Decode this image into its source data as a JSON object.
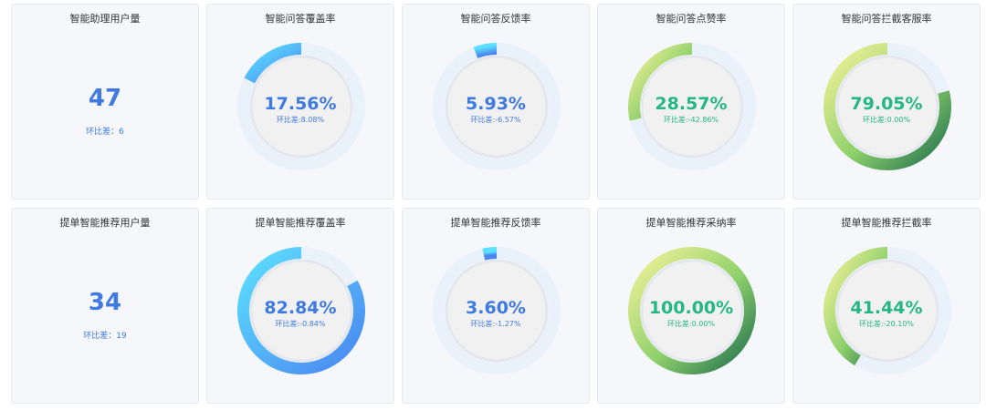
{
  "cards": [
    {
      "title": "智能助理用户量",
      "kind": "stat",
      "value": "47",
      "delta": "环比差：6"
    },
    {
      "title": "智能问答覆盖率",
      "kind": "gauge",
      "value": "17.56%",
      "delta": "环比差:8.08%",
      "fraction": 0.1756,
      "scheme": "cyan",
      "text_color": "#3f7ae0"
    },
    {
      "title": "智能问答反馈率",
      "kind": "gauge",
      "value": "5.93%",
      "delta": "环比差:-6.57%",
      "fraction": 0.0593,
      "scheme": "cyan",
      "text_color": "#3f7ae0"
    },
    {
      "title": "智能问答点赞率",
      "kind": "gauge",
      "value": "28.57%",
      "delta": "环比差:-42.86%",
      "fraction": 0.2857,
      "scheme": "green",
      "text_color": "#25b685"
    },
    {
      "title": "智能问答拦截客服率",
      "kind": "gauge",
      "value": "79.05%",
      "delta": "环比差:0.00%",
      "fraction": 0.7905,
      "scheme": "green",
      "text_color": "#25b685"
    },
    {
      "title": "提单智能推荐用户量",
      "kind": "stat",
      "value": "34",
      "delta": "环比差：19"
    },
    {
      "title": "提单智能推荐覆盖率",
      "kind": "gauge",
      "value": "82.84%",
      "delta": "环比差:-0.84%",
      "fraction": 0.8284,
      "scheme": "cyan",
      "text_color": "#3f7ae0"
    },
    {
      "title": "提单智能推荐反馈率",
      "kind": "gauge",
      "value": "3.60%",
      "delta": "环比差:-1.27%",
      "fraction": 0.036,
      "scheme": "cyan",
      "text_color": "#3f7ae0"
    },
    {
      "title": "提单智能推荐采纳率",
      "kind": "gauge",
      "value": "100.00%",
      "delta": "环比差:0.00%",
      "fraction": 1.0,
      "scheme": "green",
      "text_color": "#25b685"
    },
    {
      "title": "提单智能推荐拦截率",
      "kind": "gauge",
      "value": "41.44%",
      "delta": "环比差:-20.10%",
      "fraction": 0.4144,
      "scheme": "green",
      "text_color": "#25b685"
    }
  ],
  "colors": {
    "cyan_start": "#5ce0ff",
    "cyan_end": "#4a86f0",
    "green_start": "#f6f29b",
    "green_mid": "#8fd16b",
    "green_end": "#1f6e4e",
    "track": "#e9f2fb",
    "inner": "#f1f1f1",
    "inner_ring": "#e4e8ee"
  }
}
